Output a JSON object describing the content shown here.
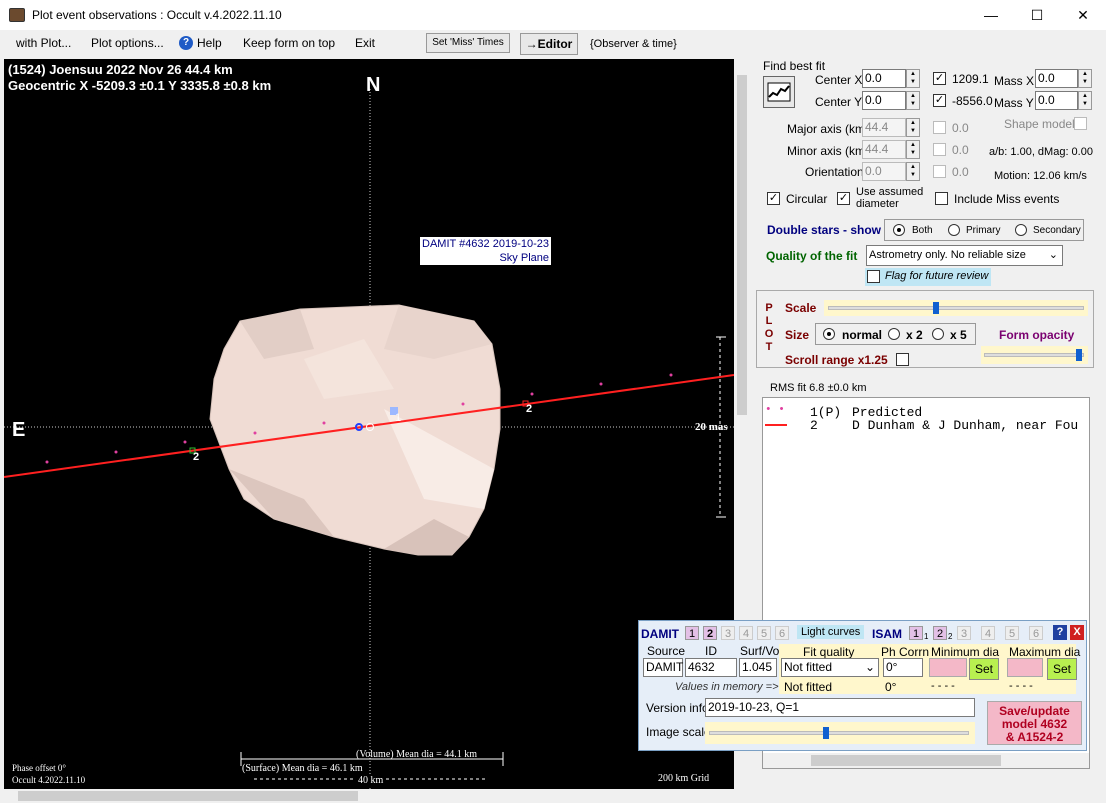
{
  "window": {
    "title": "Plot event observations : Occult v.4.2022.11.10",
    "minimize_glyph": "—",
    "maximize_glyph": "☐",
    "close_glyph": "✕"
  },
  "menu": {
    "with_plot": "with Plot...",
    "plot_options": "Plot options...",
    "help": "Help",
    "keep_on_top": "Keep form on top",
    "exit": "Exit",
    "set_miss_times": "Set 'Miss' Times",
    "editor": "→Editor",
    "observer_time": "{Observer & time}"
  },
  "plot": {
    "header_line1": "(1524) Joensuu  2022 Nov 26   44.4 km",
    "header_line2": "Geocentric  X  -5209.3 ±0.1  Y 3335.8 ±0.8 km",
    "north": "N",
    "east": "E",
    "model_label1": "DAMIT #4632 2019-10-23",
    "model_label2": "Sky Plane",
    "scale_20mas": "20 mas",
    "chord1_label": "1",
    "chord2_label_left": "2",
    "chord2_label_right": "2",
    "volume_dia": "(Volume) Mean dia = 44.1 km",
    "surface_dia": "(Surface) Mean dia = 46.1 km",
    "scale_40km": "40 km",
    "phase_offset": "Phase offset 0°",
    "version": "Occult 4.2022.11.10",
    "grid": "200 km Grid"
  },
  "fit": {
    "find_best_fit": "Find best fit",
    "center_x_label": "Center X",
    "center_x": "0.0",
    "center_y_label": "Center Y",
    "center_y": "0.0",
    "x_value": "1209.1",
    "y_value": "-8556.0",
    "mass_x_label": "Mass X",
    "mass_x": "0.0",
    "mass_y_label": "Mass Y",
    "mass_y": "0.0",
    "major_axis_label": "Major axis (km)",
    "major_axis": "44.4",
    "minor_axis_label": "Minor axis (km)",
    "minor_axis": "44.4",
    "orientation_label": "Orientation",
    "orientation": "0.0",
    "major_adj": "0.0",
    "minor_adj": "0.0",
    "orient_adj": "0.0",
    "shape_model": "Shape model",
    "ab_dmag": "a/b: 1.00, dMag: 0.00",
    "motion": "Motion: 12.06 km/s",
    "circular": "Circular",
    "use_assumed1": "Use assumed",
    "use_assumed2": "diameter",
    "include_miss": "Include Miss events"
  },
  "double_stars": {
    "label": "Double stars - show",
    "both": "Both",
    "primary": "Primary",
    "secondary": "Secondary"
  },
  "quality": {
    "label": "Quality of the fit",
    "value": "Astrometry only. No reliable size",
    "flag": "Flag for future review"
  },
  "plotbox": {
    "side_letters": [
      "P",
      "L",
      "O",
      "T"
    ],
    "scale": "Scale",
    "size": "Size",
    "normal": "normal",
    "x2": "x 2",
    "x5": "x 5",
    "form_opacity": "Form opacity",
    "scroll_range": "Scroll range x1.25",
    "scale_level": 0.42,
    "opacity_level": 0.98
  },
  "rms": "RMS fit 6.8 ±0.0 km",
  "observers": [
    {
      "marker": "• •",
      "num": "1(P)",
      "name": "Predicted"
    },
    {
      "marker": "——",
      "num": "2",
      "name": "D Dunham & J Dunham, near Fou"
    }
  ],
  "damit": {
    "damit_label": "DAMIT",
    "damit_models": [
      "1",
      "2",
      "3",
      "4",
      "5",
      "6"
    ],
    "light_curves": "Light curves",
    "isam_label": "ISAM",
    "isam_models": [
      "1",
      "2",
      "3",
      "4",
      "5",
      "6"
    ],
    "isam_sub1": "1",
    "isam_sub2": "2",
    "help": "?",
    "close": "X",
    "source_h": "Source",
    "id_h": "ID",
    "surfvol_h": "Surf/Vol",
    "source": "DAMIT",
    "id": "4632",
    "surfvol": "1.045",
    "fit_quality_h": "Fit quality",
    "fit_quality": "Not fitted",
    "fit_quality2": "Not fitted",
    "phcorr_h": "Ph Corrn",
    "phcorr": "0°",
    "phcorr2": "0°",
    "min_dia_h": "Minimum dia",
    "max_dia_h": "Maximum dia",
    "set": "Set",
    "dashes": "- - - -",
    "values_in_memory": "Values in memory =>",
    "version_info_label": "Version info",
    "version_info": "2019-10-23, Q=1",
    "image_scale_label": "Image scale",
    "image_scale_level": 0.45,
    "save1": "Save/update",
    "save2": "model 4632",
    "save3": "& A1524-2"
  },
  "colors": {
    "chord": "#ff2020",
    "asteroid": "#f0dcd4",
    "damit_model_on": "#e3c0e6",
    "save_button": "#f4b8c8",
    "set_button": "#b8f050"
  }
}
